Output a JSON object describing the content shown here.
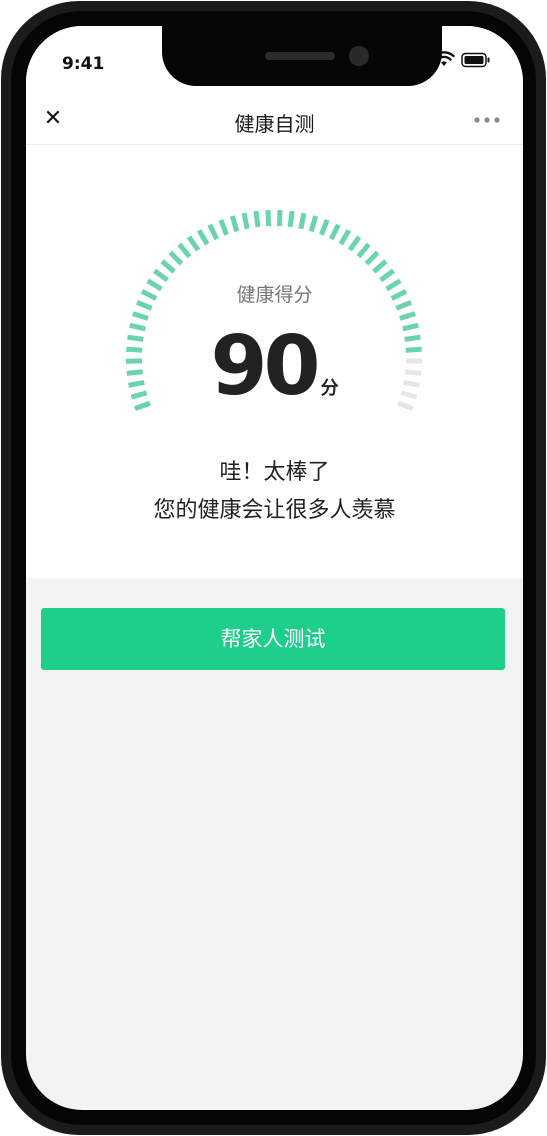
{
  "status_bar": {
    "time": "9:41"
  },
  "nav": {
    "close_icon": "close-icon",
    "title": "健康自测",
    "more_icon": "more-dots-icon"
  },
  "score": {
    "label": "健康得分",
    "value": "90",
    "unit": "分",
    "fraction": 0.9
  },
  "message": {
    "line1": "哇！太棒了",
    "line2": "您的健康会让很多人羡慕"
  },
  "action": {
    "label": "帮家人测试"
  },
  "colors": {
    "accent": "#1dcf8b",
    "gauge_active": "#6ad4ac",
    "gauge_inactive": "#e6e6e6",
    "page_bg": "#f3f3f3"
  }
}
